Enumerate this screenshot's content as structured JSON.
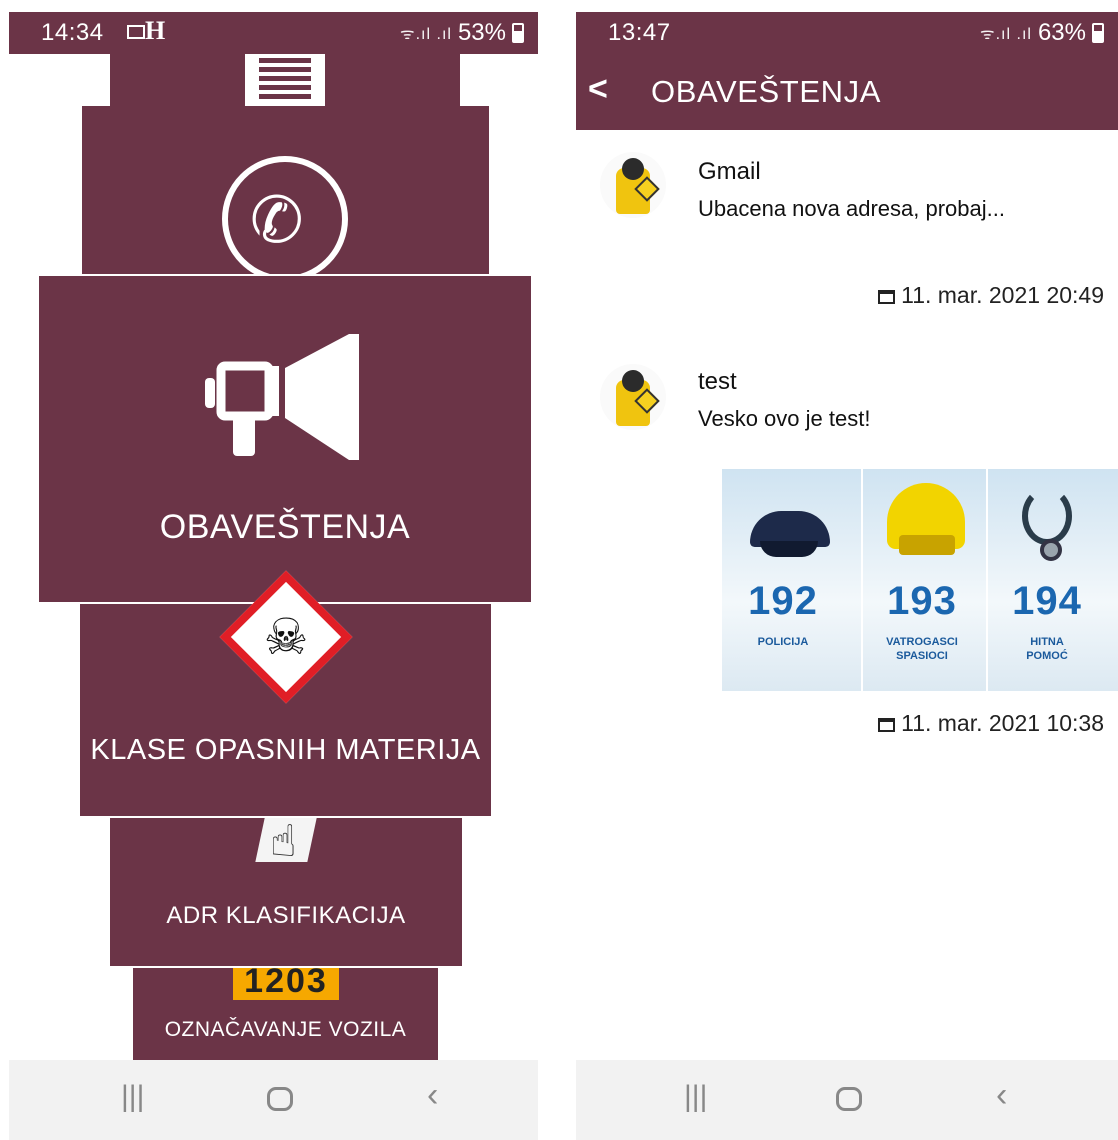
{
  "left": {
    "status": {
      "time": "14:34",
      "signal": "ᯤ.ıl .ıl",
      "battery": "53%"
    },
    "menu": {
      "obavestenja": "OBAVEŠTENJA",
      "klase": "KLASE OPASNIH MATERIJA",
      "adr": "ADR KLASIFIKACIJA",
      "oznacavanje": "OZNAČAVANJE VOZILA",
      "un_plate": "1203"
    }
  },
  "right": {
    "status": {
      "time": "13:47",
      "signal": "ᯤ.ıl .ıl",
      "battery": "63%"
    },
    "appbar": {
      "title": "OBAVEŠTENJA"
    },
    "notifications": [
      {
        "title": "Gmail",
        "body": "Ubacena nova adresa, probaj...",
        "date": "11. mar. 2021 20:49"
      },
      {
        "title": "test",
        "body": "Vesko ovo je test!",
        "date": "11. mar. 2021 10:38"
      }
    ],
    "emergency_image": {
      "numbers": [
        "192",
        "193",
        "194"
      ],
      "labels": [
        "POLICIJA",
        "VATROGASCI SPASIOCI",
        "HITNA POMOĆ"
      ]
    }
  },
  "icons": {
    "phone": "phone-icon",
    "megaphone": "megaphone-icon",
    "hazard": "skull-crossbones-icon",
    "hand": "pointing-hand-icon",
    "calendar": "calendar-icon",
    "back": "chevron-left-icon"
  },
  "colors": {
    "brand": "#6b3447",
    "hazard_red": "#e01e26",
    "plate_orange": "#f6a800",
    "number_blue": "#1b67b0"
  }
}
